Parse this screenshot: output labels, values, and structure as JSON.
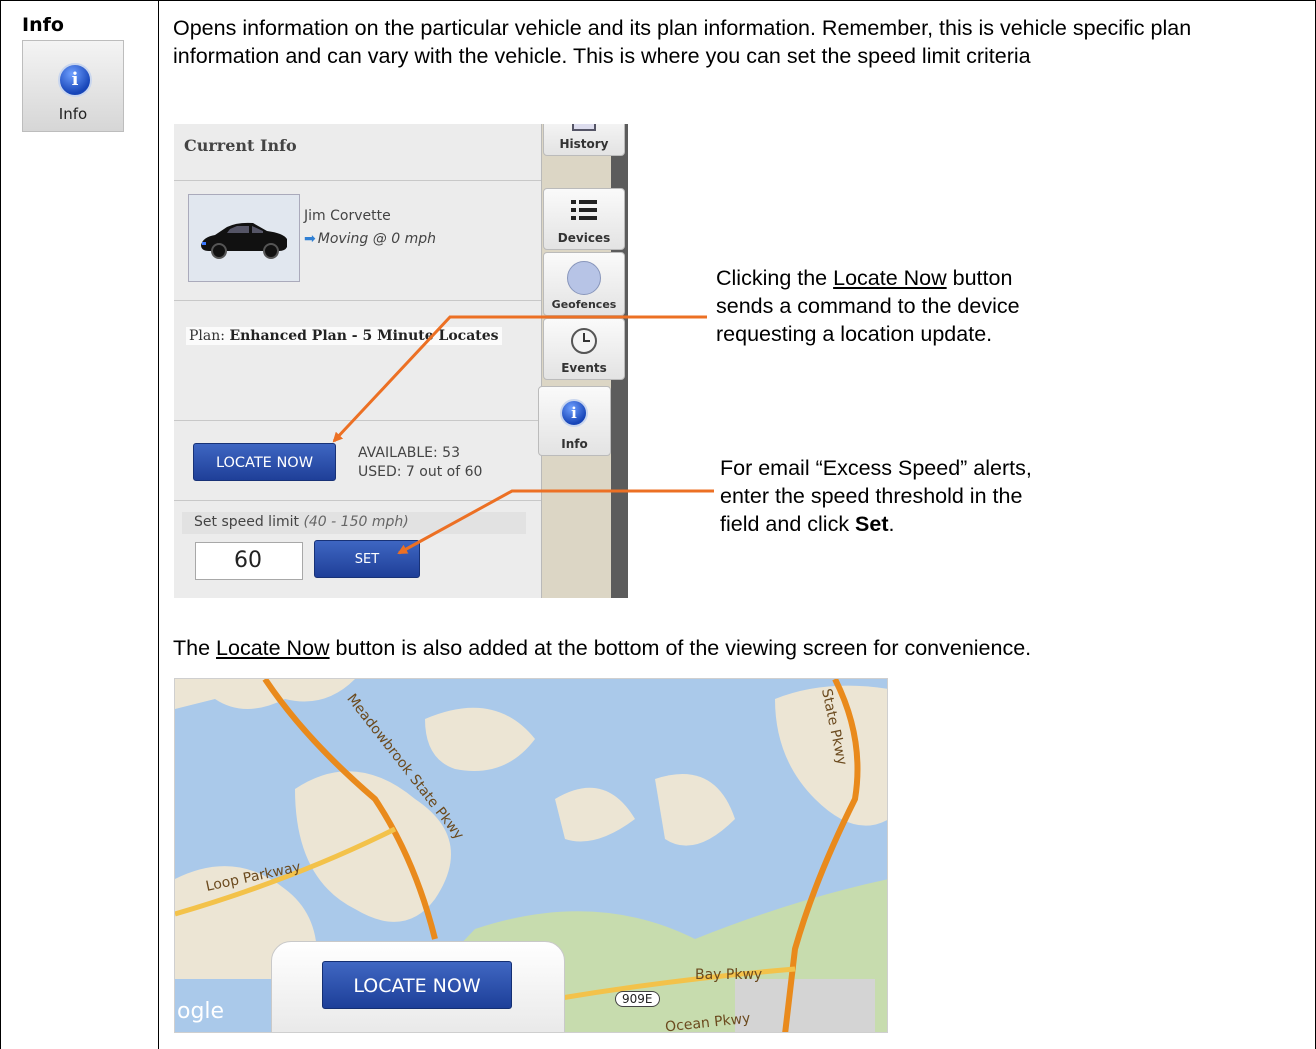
{
  "row": {
    "title": "Info",
    "icon": {
      "name": "info-icon",
      "label": "Info",
      "glyph": "i"
    },
    "description": "Opens information on the particular vehicle and its plan information.  Remember, this is vehicle specific plan information and can vary with the vehicle.  This is where you can set the speed limit criteria"
  },
  "panel": {
    "title": "Current Info",
    "vehicle_name": "Jim Corvette",
    "vehicle_status": "Moving @ 0 mph",
    "plan_prefix": "Plan: ",
    "plan_name": "Enhanced Plan - 5 Minute Locates",
    "locate_button": "LOCATE NOW",
    "available": "AVAILABLE: 53",
    "used": "USED: 7 out of 60",
    "speed_label": "Set speed limit",
    "speed_range": "(40 - 150 mph)",
    "speed_value": "60",
    "set_button": "SET"
  },
  "tabs": [
    {
      "label": "History",
      "icon": "history-icon"
    },
    {
      "label": "Devices",
      "icon": "list-icon"
    },
    {
      "label": "Geofences",
      "icon": "circle-icon"
    },
    {
      "label": "Events",
      "icon": "clock-icon"
    },
    {
      "label": "Info",
      "icon": "info-icon"
    }
  ],
  "callouts": {
    "locate_1a": "Clicking the ",
    "locate_link": "Locate Now",
    "locate_1b": " button",
    "locate_2": "sends a command to the device",
    "locate_3": "requesting a location update.",
    "speed_1": "For email “Excess Speed” alerts,",
    "speed_2": "enter the speed threshold in the",
    "speed_3a": "field and click ",
    "speed_bold": "Set",
    "speed_3b": "."
  },
  "footer_note": {
    "a": "The ",
    "link": "Locate Now",
    "b": " button is also added at the bottom of the viewing screen for convenience."
  },
  "map": {
    "labels": [
      "Meadowbrook State Pkwy",
      "Loop Parkway",
      "State Pkwy",
      "Bay Pkwy",
      "909E",
      "Ocean Pkwy",
      "ogle"
    ],
    "locate_button": "LOCATE NOW"
  },
  "colors": {
    "arrow": "#ec7024",
    "button": "#2a4fae",
    "road": "#f08c1c"
  }
}
